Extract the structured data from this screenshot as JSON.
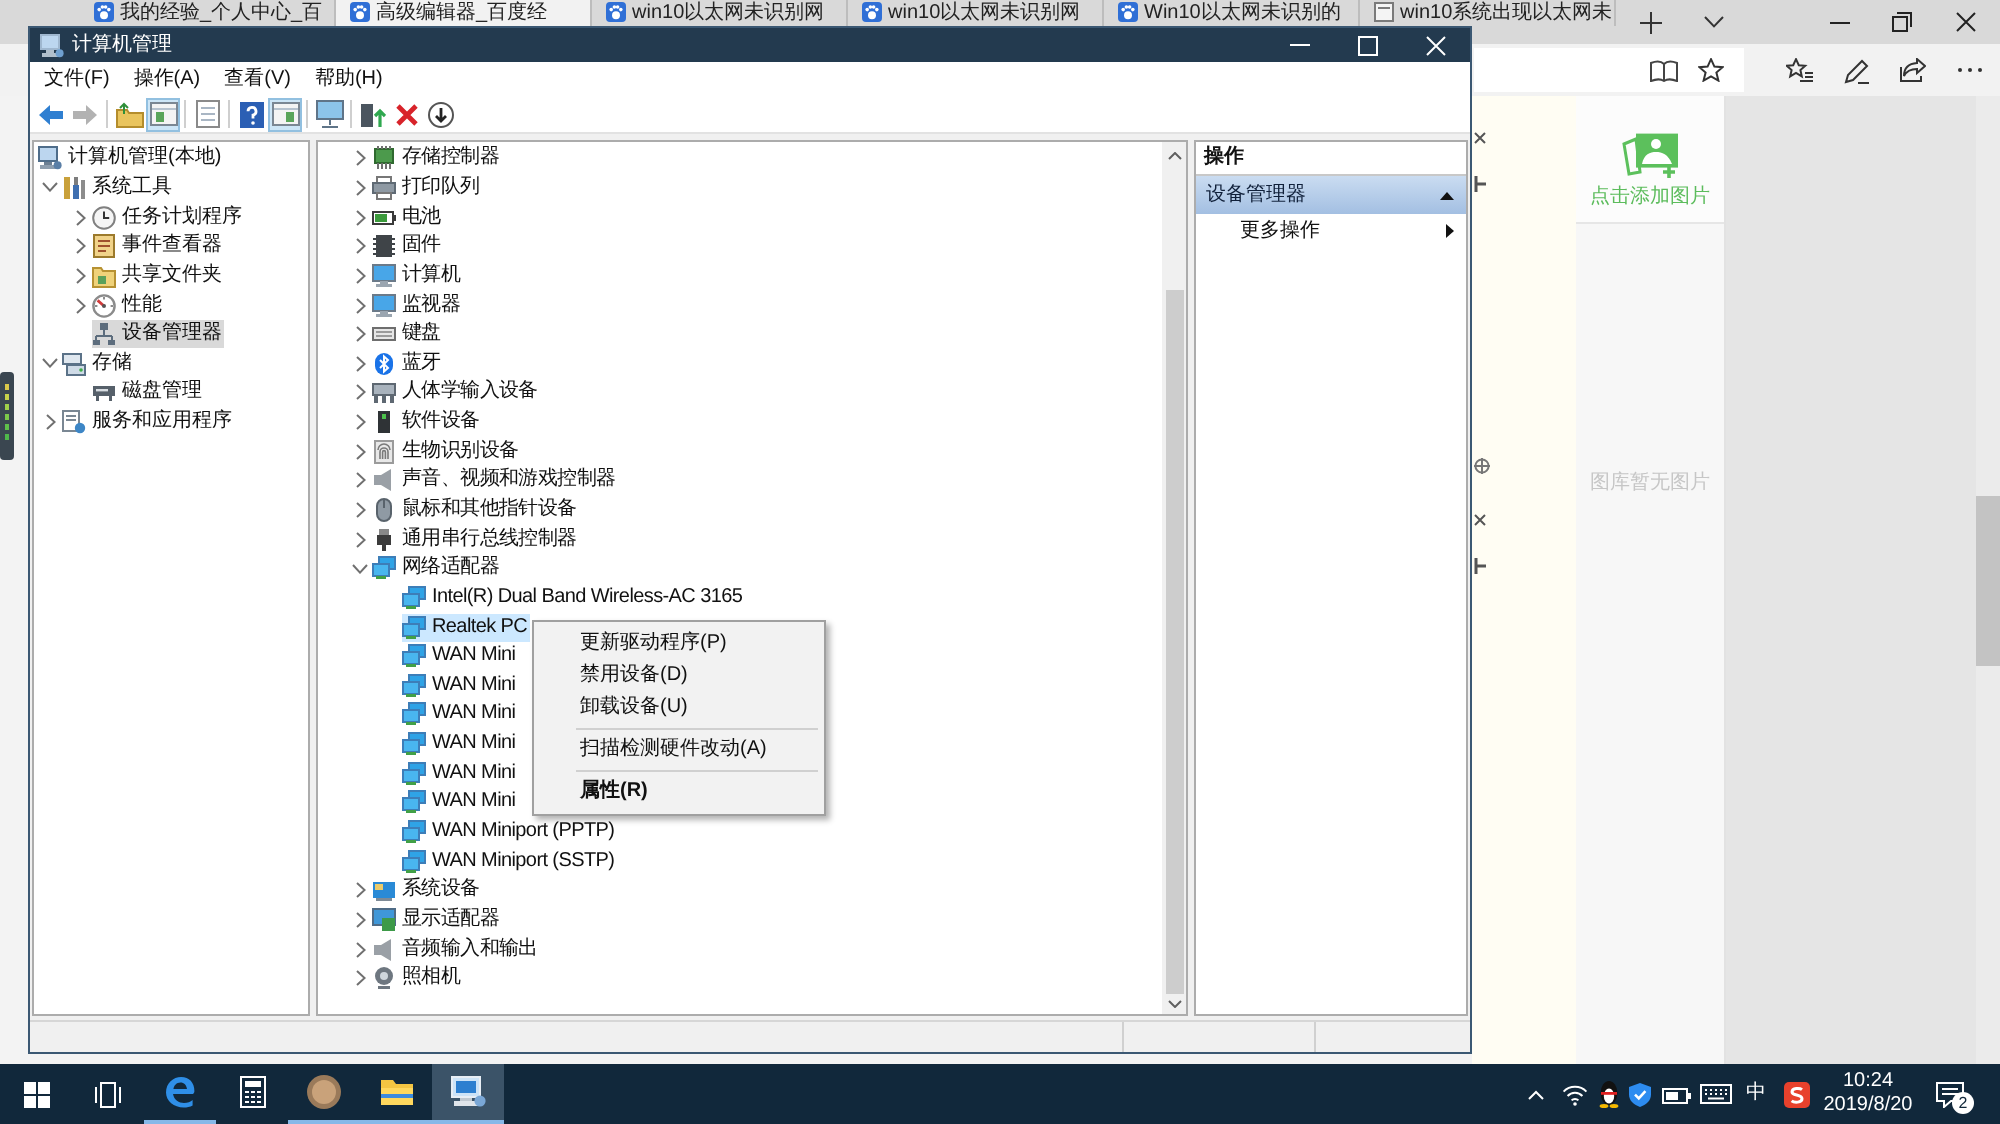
{
  "browser": {
    "tabs": [
      {
        "title": "我的经验_个人中心_百",
        "selected": false
      },
      {
        "title": "高级编辑器_百度经",
        "selected": true
      },
      {
        "title": "win10以太网未识别网",
        "selected": false
      },
      {
        "title": "win10以太网未识别网",
        "selected": false
      },
      {
        "title": "Win10以太网未识别的",
        "selected": false
      },
      {
        "title": "win10系统出现以太网未",
        "selected": false
      }
    ],
    "image_panel": {
      "add_label": "点击添加图片",
      "empty_label": "图库暂无图片"
    }
  },
  "window": {
    "title": "计算机管理"
  },
  "menu_bar": [
    "文件(F)",
    "操作(A)",
    "查看(V)",
    "帮助(H)"
  ],
  "toolbar": {
    "groups": [
      [
        {
          "disabled": false,
          "pressed": false
        },
        {
          "disabled": true,
          "pressed": false
        }
      ],
      [
        {
          "disabled": false,
          "pressed": false
        },
        {
          "disabled": false,
          "pressed": true
        }
      ],
      [
        {
          "disabled": false,
          "pressed": false
        }
      ],
      [
        {
          "disabled": false,
          "pressed": false
        },
        {
          "disabled": false,
          "pressed": true
        }
      ],
      [
        {
          "disabled": false,
          "pressed": false
        }
      ],
      [
        {
          "disabled": false,
          "pressed": false
        },
        {
          "disabled": false,
          "pressed": false
        },
        {
          "disabled": false,
          "pressed": false
        }
      ]
    ]
  },
  "console_tree": [
    {
      "label": "计算机管理(本地)",
      "selected": false,
      "children": [
        {
          "label": "系统工具",
          "expanded": true,
          "selected": false,
          "children": [
            {
              "label": "任务计划程序",
              "expanded": false,
              "selected": false
            },
            {
              "label": "事件查看器",
              "expanded": false,
              "selected": false
            },
            {
              "label": "共享文件夹",
              "expanded": false,
              "selected": false
            },
            {
              "label": "性能",
              "expanded": false,
              "selected": false
            },
            {
              "label": "设备管理器",
              "selected": true
            }
          ]
        },
        {
          "label": "存储",
          "expanded": true,
          "selected": false,
          "children": [
            {
              "label": "磁盘管理",
              "selected": false
            }
          ]
        },
        {
          "label": "服务和应用程序",
          "expanded": false,
          "selected": false
        }
      ]
    }
  ],
  "device_tree": [
    {
      "label": "存储控制器",
      "expanded": false,
      "selected": false
    },
    {
      "label": "打印队列",
      "expanded": false,
      "selected": false
    },
    {
      "label": "电池",
      "expanded": false,
      "selected": false
    },
    {
      "label": "固件",
      "expanded": false,
      "selected": false
    },
    {
      "label": "计算机",
      "expanded": false,
      "selected": false
    },
    {
      "label": "监视器",
      "expanded": false,
      "selected": false
    },
    {
      "label": "键盘",
      "expanded": false,
      "selected": false
    },
    {
      "label": "蓝牙",
      "expanded": false,
      "selected": false
    },
    {
      "label": "人体学输入设备",
      "expanded": false,
      "selected": false
    },
    {
      "label": "软件设备",
      "expanded": false,
      "selected": false
    },
    {
      "label": "生物识别设备",
      "expanded": false,
      "selected": false
    },
    {
      "label": "声音、视频和游戏控制器",
      "expanded": false,
      "selected": false
    },
    {
      "label": "鼠标和其他指针设备",
      "expanded": false,
      "selected": false
    },
    {
      "label": "通用串行总线控制器",
      "expanded": false,
      "selected": false
    },
    {
      "label": "网络适配器",
      "expanded": true,
      "selected": false,
      "children": [
        {
          "label": "Intel(R) Dual Band Wireless-AC 3165",
          "selected": false
        },
        {
          "label": "Realtek PC",
          "selected": true
        },
        {
          "label": "WAN Mini",
          "selected": false
        },
        {
          "label": "WAN Mini",
          "selected": false
        },
        {
          "label": "WAN Mini",
          "selected": false
        },
        {
          "label": "WAN Mini",
          "selected": false
        },
        {
          "label": "WAN Mini",
          "selected": false
        },
        {
          "label": "WAN Mini",
          "selected": false
        },
        {
          "label": "WAN Miniport (PPTP)",
          "selected": false
        },
        {
          "label": "WAN Miniport (SSTP)",
          "selected": false
        }
      ]
    },
    {
      "label": "系统设备",
      "expanded": false,
      "selected": false
    },
    {
      "label": "显示适配器",
      "expanded": false,
      "selected": false
    },
    {
      "label": "音频输入和输出",
      "expanded": false,
      "selected": false
    },
    {
      "label": "照相机",
      "expanded": false,
      "selected": false
    }
  ],
  "context_menu": [
    {
      "kind": "item",
      "label": "更新驱动程序(P)",
      "default": false
    },
    {
      "kind": "item",
      "label": "禁用设备(D)",
      "default": false
    },
    {
      "kind": "item",
      "label": "卸载设备(U)",
      "default": false
    },
    {
      "kind": "separator"
    },
    {
      "kind": "item",
      "label": "扫描检测硬件改动(A)",
      "default": false
    },
    {
      "kind": "separator"
    },
    {
      "kind": "item",
      "label": "属性(R)",
      "default": true
    }
  ],
  "actions_pane": {
    "title": "操作",
    "sections": [
      {
        "label": "设备管理器",
        "expanded": true,
        "items": [
          {
            "label": "更多操作",
            "submenu": true
          }
        ]
      }
    ]
  },
  "taskbar": {
    "apps": [
      {
        "running": true,
        "active": false
      },
      {
        "running": false,
        "active": false
      },
      {
        "running": true,
        "active": false
      },
      {
        "running": true,
        "active": false
      },
      {
        "running": true,
        "active": true
      }
    ],
    "input_method": "中",
    "time": "10:24",
    "date": "2019/8/20",
    "notification_count": "2"
  }
}
